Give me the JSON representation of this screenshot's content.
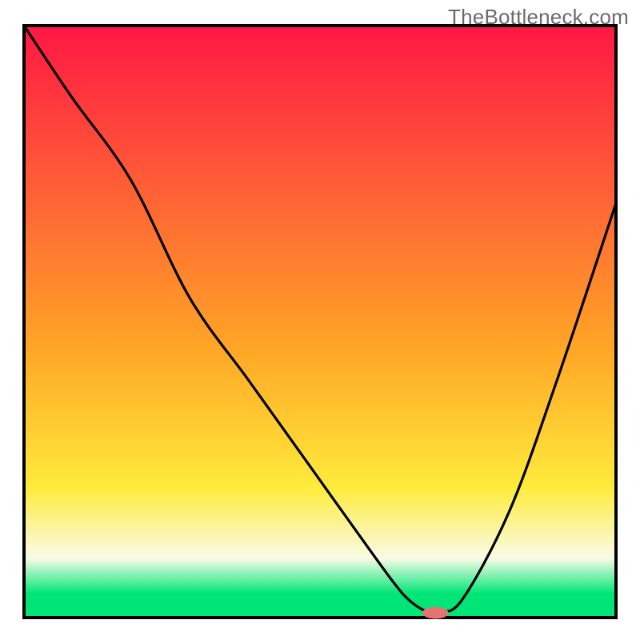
{
  "watermark": {
    "text": "TheBottleneck.com"
  },
  "chart_data": {
    "type": "line",
    "title": "",
    "xlabel": "",
    "ylabel": "",
    "xlim": [
      0,
      100
    ],
    "ylim": [
      0,
      100
    ],
    "gradient_stops": [
      {
        "offset": 0,
        "color": "#ff1744"
      },
      {
        "offset": 55,
        "color": "#ffa726"
      },
      {
        "offset": 78,
        "color": "#ffeb3b"
      },
      {
        "offset": 90,
        "color": "#f9fbe7"
      },
      {
        "offset": 96,
        "color": "#00e676"
      }
    ],
    "series": [
      {
        "name": "bottleneck-curve",
        "type": "curve",
        "x": [
          0,
          8,
          18,
          28,
          38,
          48,
          58,
          64,
          68,
          70,
          74,
          82,
          90,
          100
        ],
        "y_from_top": [
          0,
          12,
          26,
          46,
          60,
          74,
          88,
          96,
          99,
          99,
          97,
          82,
          60,
          30
        ]
      }
    ],
    "marker": {
      "x": 69.5,
      "y_from_top": 99.2,
      "rx": 2.2,
      "ry": 1.0,
      "color": "#e57373"
    },
    "annotations": []
  }
}
